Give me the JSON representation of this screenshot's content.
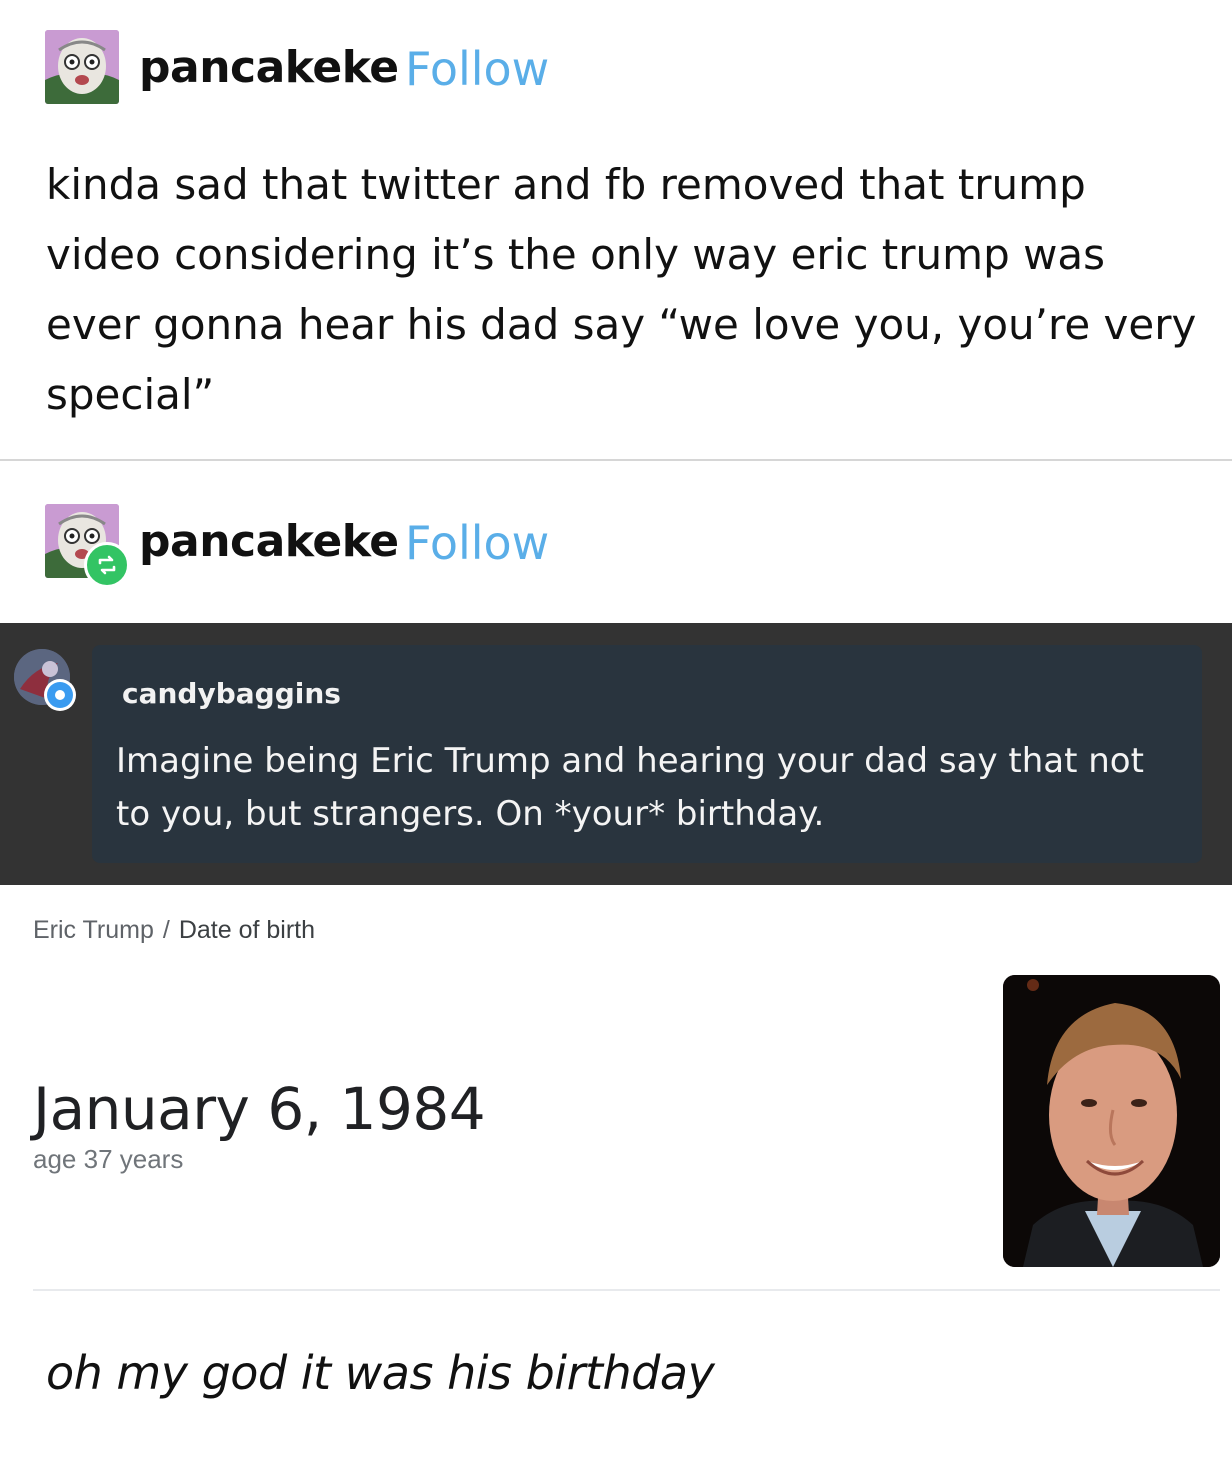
{
  "post": {
    "username": "pancakeke",
    "follow_label": "Follow",
    "text": "kinda sad that twitter and fb removed that trump video considering it’s the only way eric trump was ever gonna hear his dad say “we love you, you’re very special”"
  },
  "reblog": {
    "username": "pancakeke",
    "follow_label": "Follow"
  },
  "tweet": {
    "username": "candybaggins",
    "text": "Imagine being Eric Trump and hearing your dad say that not to you, but strangers. On *your* birthday."
  },
  "search_result": {
    "breadcrumb": [
      "Eric Trump",
      "/",
      "Date of birth"
    ],
    "date_of_birth": "January 6, 1984",
    "age": "age 37 years"
  },
  "comment": {
    "text": "oh my god it was his birthday"
  },
  "colors": {
    "follow": "#5aaee8",
    "reblog_badge": "#33c464",
    "dark_band": "#333333",
    "tweet_card": "#29343e"
  }
}
